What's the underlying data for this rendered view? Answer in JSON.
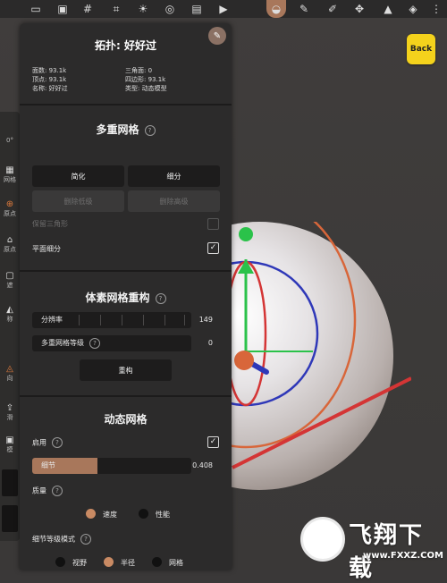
{
  "toolbar": {
    "icons": [
      "file-icon",
      "image-icon",
      "graph-icon",
      "grid-icon",
      "sun-icon",
      "globe-icon",
      "camera-icon",
      "video-icon",
      "topology-icon",
      "brush-icon",
      "pen-icon",
      "move-icon",
      "triangle-icon",
      "layers-icon",
      "more-icon"
    ]
  },
  "left_strip": {
    "items": [
      {
        "label": "0°"
      },
      {
        "label": "网格"
      },
      {
        "label": "原点"
      },
      {
        "label": "原点"
      },
      {
        "label": "遮"
      },
      {
        "label": "称"
      },
      {
        "label": "向"
      },
      {
        "label": "滑"
      },
      {
        "label": "模"
      }
    ]
  },
  "back_button": {
    "label": "Back"
  },
  "panel": {
    "title": "拓扑: 好好过",
    "info": {
      "faces": "面数: 93.1k",
      "triangles": "三角面: 0",
      "vertices": "顶点: 93.1k",
      "quads": "四边形: 93.1k",
      "name": "名称: 好好过",
      "type": "类型: 动态模型"
    },
    "multires": {
      "title": "多重网格",
      "simplify": "简化",
      "subdivide": "细分",
      "lower_disabled": "删除低级",
      "higher_disabled": "删除高级",
      "keep_triangles": "保留三角形",
      "keep_triangles_checked": false,
      "linear_subdiv": "平面细分",
      "linear_subdiv_checked": true,
      "check_mark": "✓"
    },
    "voxel": {
      "title": "体素网格重构",
      "resolution_label": "分辨率",
      "resolution_value": "149",
      "multires_level_label": "多重网格等级",
      "multires_level_value": "0",
      "remesh": "重构"
    },
    "dynamic": {
      "title": "动态网格",
      "enable_label": "启用",
      "enable_checked": true,
      "detail_label": "细节",
      "detail_value": "0.408",
      "detail_fraction": 0.408,
      "quality_label": "质量",
      "quality_options": [
        "速度",
        "性能"
      ],
      "quality_selected": "速度",
      "level_mode_label": "细节等级模式",
      "level_mode_options": [
        "视野",
        "半径",
        "网格"
      ],
      "level_mode_selected": "半径"
    }
  },
  "watermark": {
    "text": "飞翔下载",
    "url": "www.FXXZ.COM"
  },
  "colors": {
    "accent": "#a8775b",
    "panel_bg": "#2c2b2b",
    "back_yellow": "#f4d21c",
    "gizmo_green": "#2bc24a",
    "gizmo_red": "#d43535",
    "gizmo_blue": "#2f38b8",
    "gizmo_orange": "#d8663a"
  }
}
